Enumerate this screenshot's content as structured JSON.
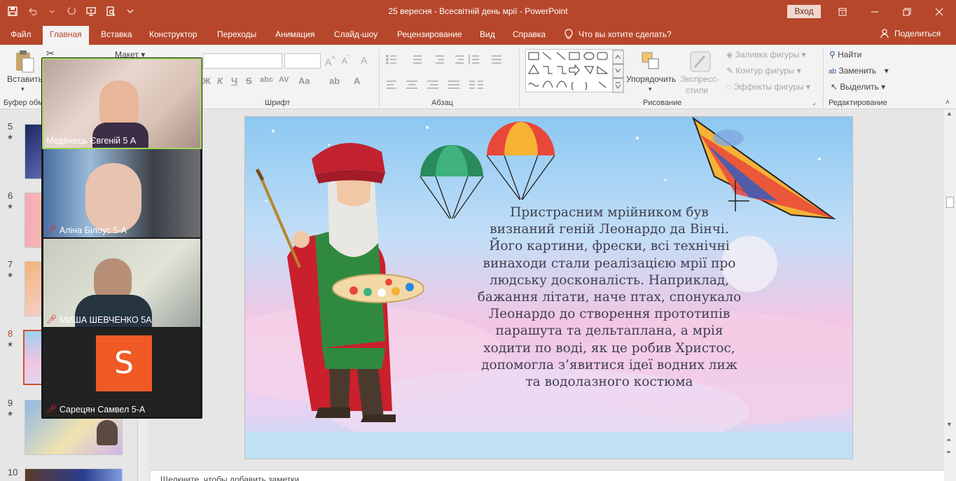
{
  "window": {
    "title": "25 вересня - Всесвітній день мрії  -  PowerPoint",
    "signin_label": "Вход",
    "accent": "#b7472a"
  },
  "tabs": [
    {
      "label": "Файл"
    },
    {
      "label": "Главная"
    },
    {
      "label": "Вставка"
    },
    {
      "label": "Конструктор"
    },
    {
      "label": "Переходы"
    },
    {
      "label": "Анимация"
    },
    {
      "label": "Слайд-шоу"
    },
    {
      "label": "Рецензирование"
    },
    {
      "label": "Вид"
    },
    {
      "label": "Справка"
    }
  ],
  "tellme": "Что вы хотите сделать?",
  "share": "Поделиться",
  "ribbon": {
    "paste": "Вставить",
    "clipboard_group": "Буфер обм",
    "layout": "Макет",
    "font_group": "Шрифт",
    "paragraph_group": "Абзац",
    "arrange": "Упорядочить",
    "quick_styles_1": "Экспресс-",
    "quick_styles_2": "стили",
    "shape_fill": "Заливка фигуры",
    "shape_outline": "Контур фигуры",
    "shape_effects": "Эффекты фигуры",
    "drawing_group": "Рисование",
    "find": "Найти",
    "replace": "Заменить",
    "select": "Выделить",
    "editing_group": "Редактирование"
  },
  "slides": [
    {
      "number": "5",
      "star": "★"
    },
    {
      "number": "6",
      "star": "★"
    },
    {
      "number": "7",
      "star": "★"
    },
    {
      "number": "8",
      "star": "★"
    },
    {
      "number": "9",
      "star": "★"
    },
    {
      "number": "10",
      "star": ""
    }
  ],
  "selected_slide": "8",
  "slide": {
    "lines": [
      "Пристрасним мрійником був",
      "визнаний геній Леонардо да Вінчі.",
      "Його картини, фрески, всі технічні",
      "винаходи стали реалізацією мрії про",
      "людську досконалість. Наприклад,",
      "бажання літати, наче птах, спонукало",
      "Леонардо до створення прототипів",
      "парашута та дельтаплана, а мрія",
      "ходити по воді, як це робив Христос,",
      "допомогла з’явитися ідеї водних лиж",
      "та водолазного костюма"
    ]
  },
  "notes_placeholder": "Щелкните, чтобы добавить заметки",
  "zoom": {
    "participants": [
      {
        "name": "Меденець Євгеній 5 А",
        "muted": false
      },
      {
        "name": "Аліна Білоус 5-А",
        "muted": true
      },
      {
        "name": "МИША ШЕВЧЕНКО 5А",
        "muted": true
      },
      {
        "name": "Сарецян Самвел 5-А",
        "muted": true
      }
    ],
    "avatar_letter": "S"
  }
}
